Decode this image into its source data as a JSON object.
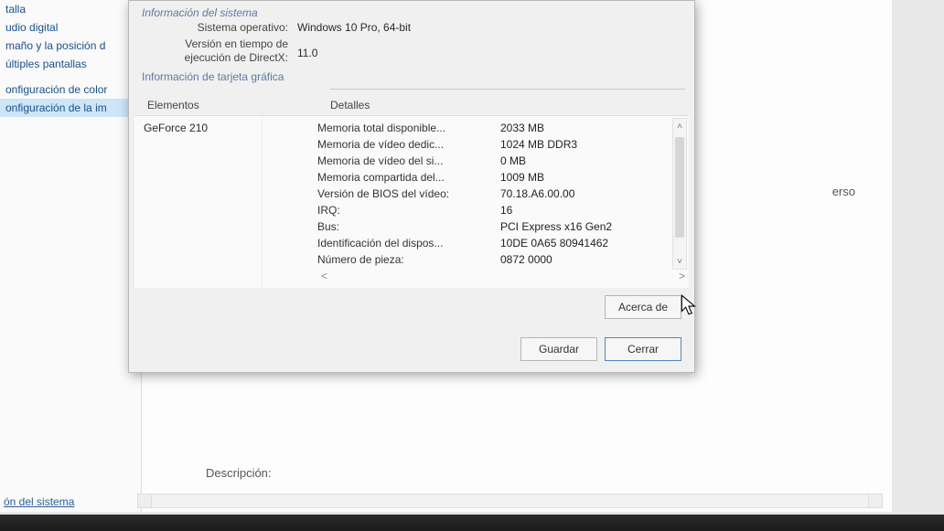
{
  "sidebar": {
    "items": [
      {
        "label": "talla"
      },
      {
        "label": "udio digital"
      },
      {
        "label": "maño y la posición d"
      },
      {
        "label": "últiples pantallas"
      }
    ],
    "group2": [
      {
        "label": "onfiguración de color"
      },
      {
        "label": "onfiguración de la im",
        "selected": true
      }
    ],
    "bottomLink": "ón del sistema"
  },
  "mainPanel": {
    "bgLabel": "erso",
    "descLabel": "Descripción:"
  },
  "dialog": {
    "sysInfoTitle": "Información del sistema",
    "osLabel": "Sistema operativo:",
    "osValue": "Windows 10 Pro, 64-bit",
    "dxLabel": "Versión en tiempo de ejecución de DirectX:",
    "dxValue": "11.0",
    "gfxTitle": "Información de tarjeta gráfica",
    "colElements": "Elementos",
    "colDetails": "Detalles",
    "elementName": "GeForce 210",
    "rows": [
      {
        "k": "Memoria total disponible...",
        "v": "2033 MB"
      },
      {
        "k": "Memoria de vídeo dedic...",
        "v": "1024 MB DDR3"
      },
      {
        "k": "Memoria de vídeo del si...",
        "v": "0 MB"
      },
      {
        "k": "Memoria compartida del...",
        "v": "1009 MB"
      },
      {
        "k": "Versión de BIOS del vídeo:",
        "v": "70.18.A6.00.00"
      },
      {
        "k": "IRQ:",
        "v": "16"
      },
      {
        "k": "Bus:",
        "v": "PCI Express x16 Gen2"
      },
      {
        "k": "Identificación del dispos...",
        "v": "10DE 0A65 80941462"
      },
      {
        "k": "Número de pieza:",
        "v": "0872 0000"
      }
    ],
    "aboutBtn": "Acerca de",
    "saveBtn": "Guardar",
    "closeBtn": "Cerrar"
  }
}
